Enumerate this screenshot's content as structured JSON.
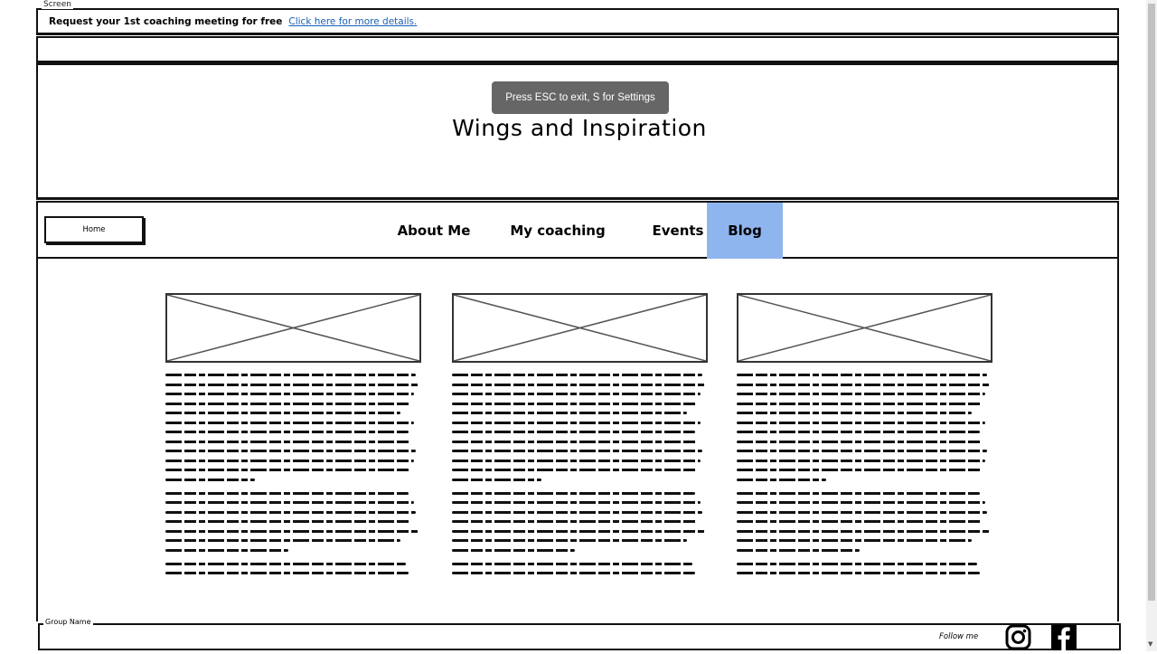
{
  "screen_label": "Screen",
  "banner": {
    "text": "Request your 1st coaching meeting for free",
    "link": "Click here for more details."
  },
  "header": {
    "title": "Wings and Inspiration",
    "toast": "Press ESC to exit, S for Settings"
  },
  "nav": {
    "home": "Home",
    "items": [
      "About Me",
      "My coaching",
      "Events",
      "Blog"
    ],
    "active": "Blog",
    "active_color": "#8fb5ef"
  },
  "footer": {
    "group_label": "Group Name",
    "follow": "Follow me",
    "icons": [
      "instagram-icon",
      "facebook-icon"
    ]
  }
}
